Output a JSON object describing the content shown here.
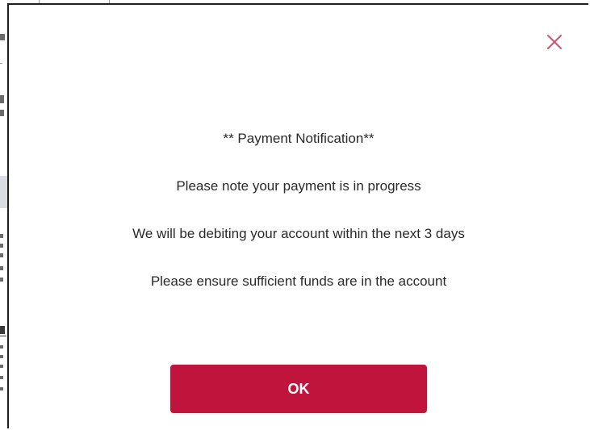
{
  "dialog": {
    "title": "** Payment Notification**",
    "messages": [
      "Please note your payment is in progress",
      "We will be debiting your account within the next 3 days",
      "Please ensure sufficient funds are in the account"
    ],
    "ok_label": "OK",
    "close_icon": "close-icon",
    "accent_color": "#c0143c",
    "close_color": "#d25470"
  }
}
